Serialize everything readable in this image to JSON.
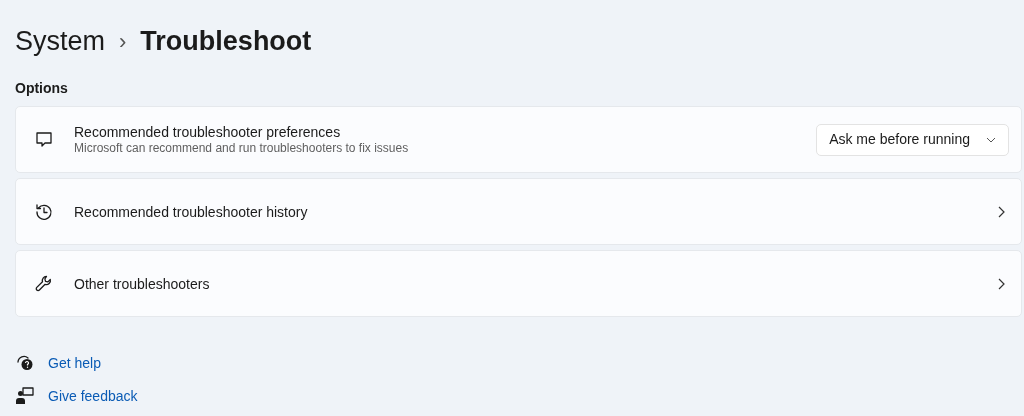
{
  "breadcrumb": {
    "parent": "System",
    "separator": "›",
    "current": "Troubleshoot"
  },
  "section_title": "Options",
  "settings": [
    {
      "kind": "dropdown",
      "title": "Recommended troubleshooter preferences",
      "description": "Microsoft can recommend and run troubleshooters to fix issues",
      "value": "Ask me before running"
    },
    {
      "kind": "link",
      "title": "Recommended troubleshooter history"
    },
    {
      "kind": "link",
      "title": "Other troubleshooters"
    }
  ],
  "footer_links": [
    {
      "label": "Get help"
    },
    {
      "label": "Give feedback"
    }
  ]
}
